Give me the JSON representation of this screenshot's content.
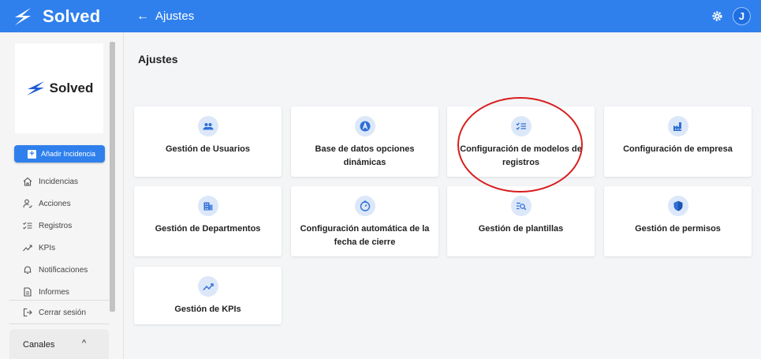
{
  "app": {
    "name": "Solved",
    "user_initial": "J"
  },
  "header": {
    "back_label": "Ajustes"
  },
  "sidebar": {
    "logo_text": "Solved",
    "add_button": "Añadir Incidencia",
    "items": [
      {
        "label": "Incidencias",
        "icon": "home-icon"
      },
      {
        "label": "Acciones",
        "icon": "user-action-icon"
      },
      {
        "label": "Registros",
        "icon": "checklist-icon"
      },
      {
        "label": "KPIs",
        "icon": "trend-icon"
      },
      {
        "label": "Notificaciones",
        "icon": "bell-icon"
      },
      {
        "label": "Informes",
        "icon": "document-icon"
      }
    ],
    "logout": "Cerrar sesión",
    "channels": "Canales"
  },
  "main": {
    "title": "Ajustes",
    "cards": [
      {
        "label": "Gestión de Usuarios",
        "icon": "users-icon"
      },
      {
        "label": "Base de datos opciones dinámicas",
        "icon": "letter-a-icon"
      },
      {
        "label": "Configuración de modelos de registros",
        "icon": "checklist-icon"
      },
      {
        "label": "Configuración de empresa",
        "icon": "factory-icon"
      },
      {
        "label": "Gestión de Departmentos",
        "icon": "building-icon"
      },
      {
        "label": "Configuración automática de la fecha de cierre",
        "icon": "timer-icon"
      },
      {
        "label": "Gestión de plantillas",
        "icon": "list-search-icon"
      },
      {
        "label": "Gestión de permisos",
        "icon": "shield-icon"
      },
      {
        "label": "Gestión de KPIs",
        "icon": "trend-icon"
      }
    ]
  },
  "colors": {
    "primary": "#2f80ed",
    "icon_bg": "#dce8f9",
    "highlight": "#d71e1e"
  }
}
